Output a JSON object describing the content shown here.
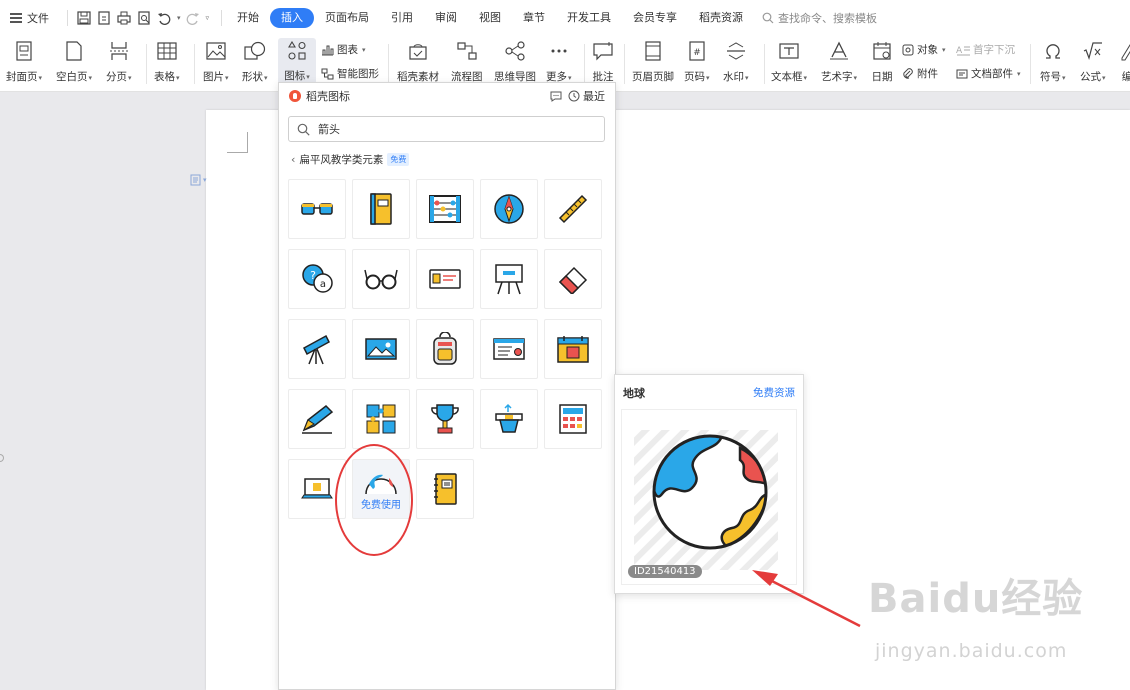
{
  "menubar": {
    "file_label": "文件",
    "tabs": [
      {
        "label": "开始"
      },
      {
        "label": "插入",
        "active": true
      },
      {
        "label": "页面布局"
      },
      {
        "label": "引用"
      },
      {
        "label": "审阅"
      },
      {
        "label": "视图"
      },
      {
        "label": "章节"
      },
      {
        "label": "开发工具"
      },
      {
        "label": "会员专享"
      },
      {
        "label": "稻壳资源"
      }
    ],
    "search_placeholder": "查找命令、搜索模板"
  },
  "ribbon": {
    "cover_page": "封面页",
    "blank_page": "空白页",
    "page_break": "分页",
    "table": "表格",
    "picture": "图片",
    "shape": "形状",
    "icon": "图标",
    "chart": "图表",
    "smart_art": "智能图形",
    "docer_material": "稻壳素材",
    "flowchart": "流程图",
    "mind_map": "思维导图",
    "more": "更多",
    "comment": "批注",
    "header_footer": "页眉页脚",
    "page_number": "页码",
    "watermark": "水印",
    "text_box": "文本框",
    "word_art": "艺术字",
    "date": "日期",
    "object": "对象",
    "attachment": "附件",
    "drop_cap": "首字下沉",
    "doc_parts": "文档部件",
    "symbol": "符号",
    "formula": "公式",
    "edit_partial": "编"
  },
  "panel": {
    "title": "稻壳图标",
    "recent": "最近",
    "search_value": "箭头",
    "breadcrumb": "扁平风教学类元素",
    "badge": "免费",
    "free_use": "免费使用"
  },
  "preview": {
    "title": "地球",
    "link": "免费资源",
    "id": "ID21540413"
  },
  "watermark": {
    "brand": "Baidu经验",
    "url": "jingyan.baidu.com"
  },
  "colors": {
    "accent": "#2f7df6",
    "annotation_red": "#e43b3b",
    "icon_blue": "#2aa7e8",
    "icon_yellow": "#f6c02c",
    "icon_red": "#e9534f"
  }
}
